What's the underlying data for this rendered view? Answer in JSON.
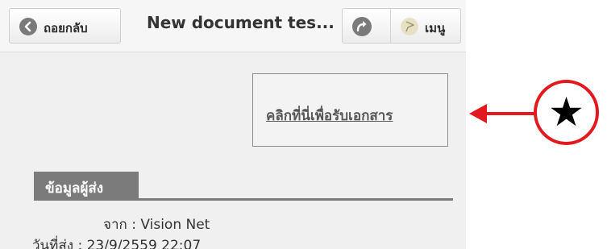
{
  "toolbar": {
    "back_label": "ถอยกลับ",
    "title": "New document tes...",
    "menu_label": "เมนู"
  },
  "download": {
    "link_text": "คลิกที่นี่เพื่อรับเอกสาร"
  },
  "sender": {
    "section_title": "ข้อมูลผู้ส่ง",
    "from_label": "จาก",
    "from_value": "Vision Net",
    "date_label": "วันที่ส่ง",
    "date_value": "23/9/2559 22:07"
  },
  "annotation": {
    "star": "★",
    "color": "#e2191e"
  },
  "icons": {
    "back": "back-arrow-icon",
    "share": "share-icon",
    "menu": "flag-icon"
  }
}
